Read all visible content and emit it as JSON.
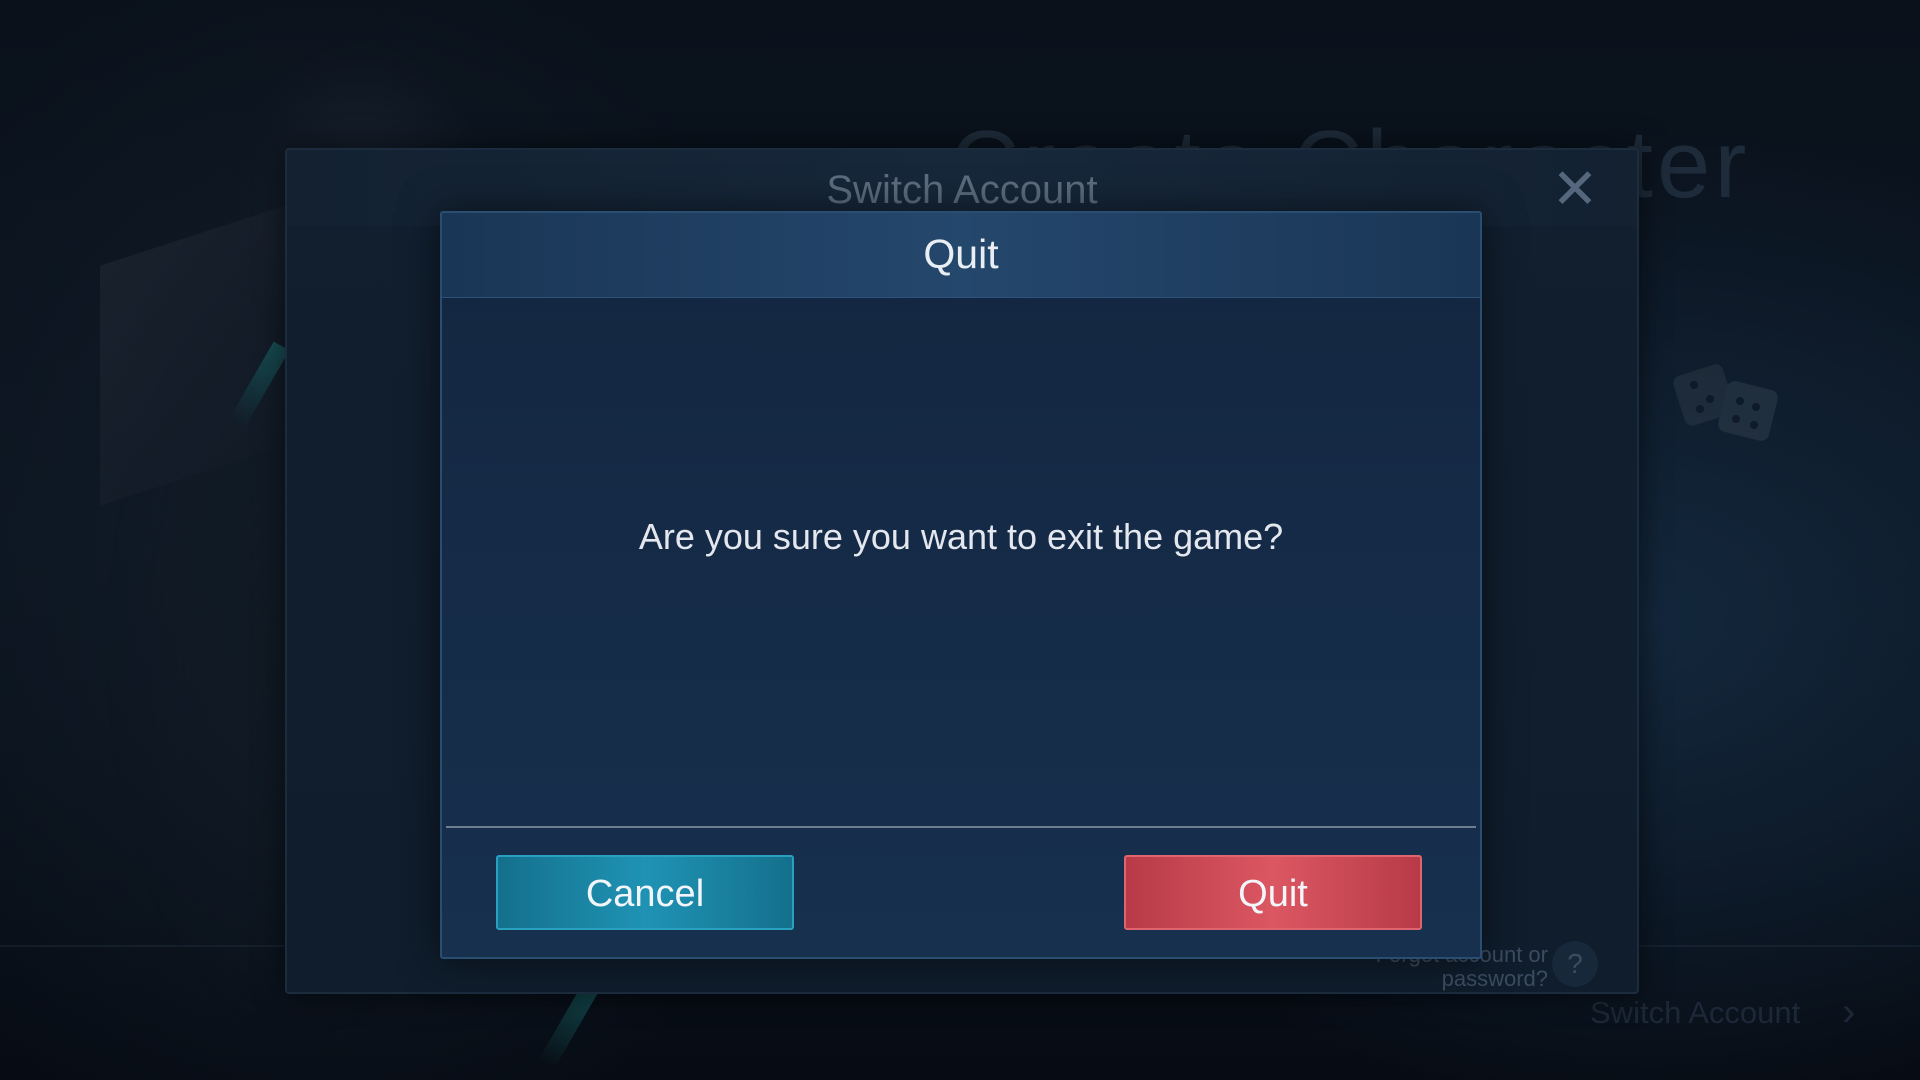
{
  "background": {
    "title": "Create Character",
    "back_icon": "back-chevron-icon",
    "dice_icon": "dice-icon",
    "forget_line1": "Forget account or",
    "forget_line2": "password?",
    "help_icon_glyph": "?",
    "switch_account_label": "Switch Account",
    "chevron_icon": "chevron-right-icon"
  },
  "switch_panel": {
    "title": "Switch Account",
    "close_icon": "close-icon"
  },
  "quit_dialog": {
    "title": "Quit",
    "message": "Are you sure you want to exit the game?",
    "cancel_label": "Cancel",
    "quit_label": "Quit"
  },
  "colors": {
    "cancel_button": "#1f93b5",
    "quit_button": "#db5762",
    "dialog_background": "#16304e"
  }
}
